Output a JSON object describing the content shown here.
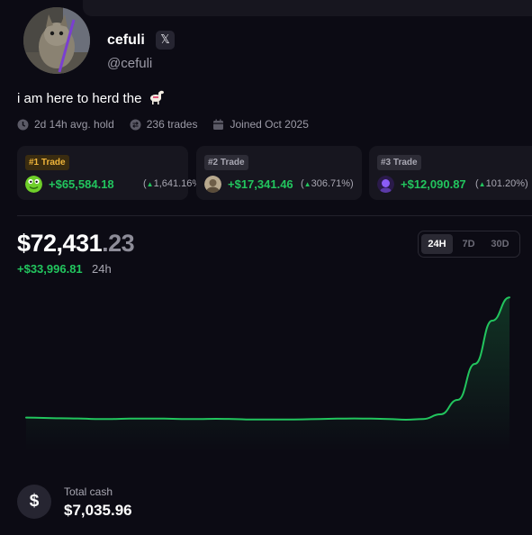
{
  "profile": {
    "name": "cefuli",
    "handle": "@cefuli",
    "x_badge": "𝕏",
    "bio": "i am here to herd the",
    "bio_emoji": "llama"
  },
  "stats": {
    "avg_hold": "2d 14h avg. hold",
    "trades": "236 trades",
    "joined": "Joined Oct 2025"
  },
  "top_trades": [
    {
      "badge": "#1 Trade",
      "profit": "+$65,584.18",
      "pct": "1,641.16%",
      "arrow": "▲",
      "icon": "green-frog-token",
      "accent": "#f0b53a"
    },
    {
      "badge": "#2 Trade",
      "profit": "+$17,341.46",
      "pct": "306.71%",
      "arrow": "▲",
      "icon": "portrait-token"
    },
    {
      "badge": "#3 Trade",
      "profit": "+$12,090.87",
      "pct": "101.20%",
      "arrow": "▲",
      "icon": "purple-token"
    }
  ],
  "portfolio": {
    "balance_main": "$72,431",
    "balance_cents": ".23",
    "delta": "+$33,996.81",
    "delta_period": "24h"
  },
  "range_tabs": [
    {
      "label": "24H",
      "active": true
    },
    {
      "label": "7D",
      "active": false
    },
    {
      "label": "30D",
      "active": false
    }
  ],
  "cash": {
    "icon": "$",
    "label": "Total cash",
    "value": "$7,035.96"
  },
  "colors": {
    "background": "#0c0b14",
    "card": "#17161f",
    "positive": "#22c55e",
    "gold": "#f0b53a"
  },
  "chart_data": {
    "type": "line",
    "title": "",
    "xlabel": "",
    "ylabel": "",
    "period": "24h",
    "series": [
      {
        "values": [
          39100,
          39000,
          38900,
          38850,
          38700,
          38700,
          38800,
          38800,
          38800,
          38700,
          38700,
          38750,
          38700,
          38550,
          38550,
          38550,
          38600,
          38700,
          38800,
          38850,
          38800,
          38700,
          38500,
          38700,
          40000,
          44000,
          54000,
          66000,
          72431
        ]
      }
    ],
    "ylim": [
      25000,
      75000
    ]
  }
}
